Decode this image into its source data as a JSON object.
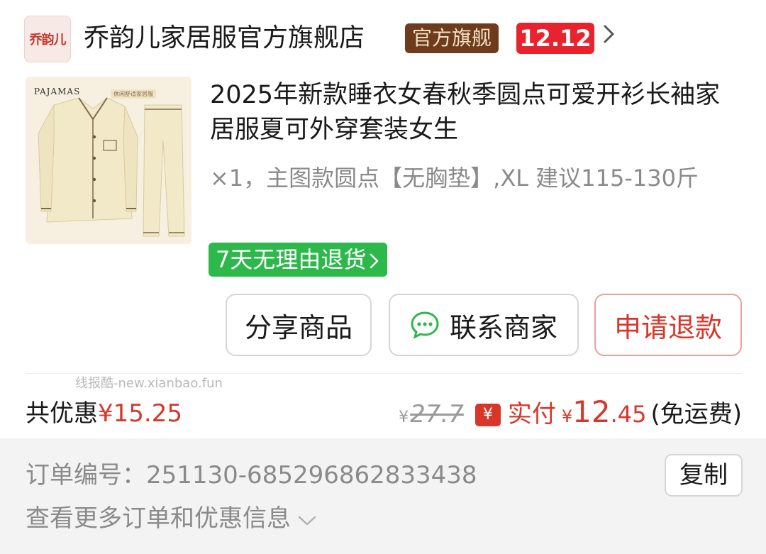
{
  "store": {
    "logo_text": "乔韵儿",
    "name": "乔韵儿家居服官方旗舰店",
    "official_badge": "官方旗舰",
    "promo_badge": "12.12",
    "chevron_icon": "chevron-right-icon"
  },
  "product": {
    "image_caption": "PAJAMAS",
    "image_tag": "休闲舒适家居服",
    "title": "2025年新款睡衣女春秋季圆点可爱开衫长袖家居服夏可外穿套装女生",
    "spec": "×1，主图款圆点【无胸垫】,XL 建议115-130斤",
    "return_tag": "7天无理由退货"
  },
  "actions": {
    "share_label": "分享商品",
    "contact_label": "联系商家",
    "refund_label": "申请退款"
  },
  "watermark": "线报酷-new.xianbao.fun",
  "pricing": {
    "savings_label": "共优惠",
    "savings_value": "¥15.25",
    "original_yen": "¥",
    "original_price": "27.7",
    "paid_icon": "¥",
    "paid_label": "实付",
    "paid_yen": "¥",
    "paid_int": "12",
    "paid_dec": ".45",
    "shipping_note": "(免运费)"
  },
  "order": {
    "number_label": "订单编号：",
    "number_value": "251130-685296862833438",
    "copy_label": "复制",
    "more_label": "查看更多订单和优惠信息"
  },
  "colors": {
    "accent_red": "#d9362a",
    "badge_brown": "#6e3b1c",
    "return_green": "#2db84b",
    "chat_green": "#2db84b"
  }
}
